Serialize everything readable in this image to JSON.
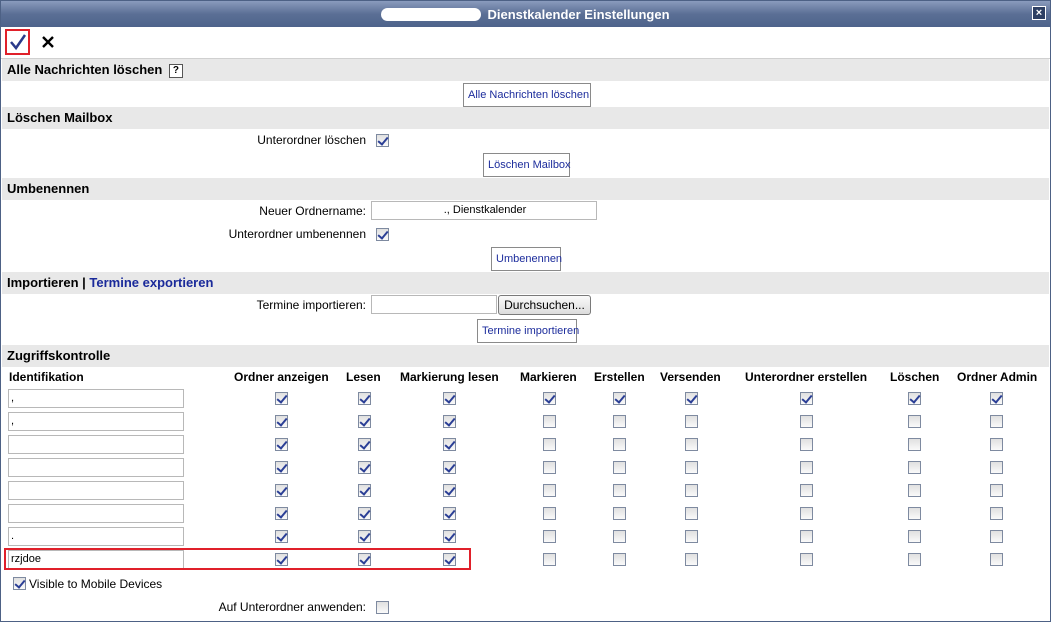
{
  "window": {
    "title": "Dienstkalender Einstellungen",
    "close_glyph": "×"
  },
  "toolbar": {
    "ok_icon": "check-icon",
    "cancel_icon": "close-icon"
  },
  "sections": {
    "delete_messages": {
      "header": "Alle Nachrichten löschen",
      "help": "?",
      "button": "Alle Nachrichten löschen"
    },
    "delete_mailbox": {
      "header": "Löschen Mailbox",
      "subfolder_label": "Unterordner löschen",
      "subfolder_checked": true,
      "button": "Löschen Mailbox"
    },
    "rename": {
      "header": "Umbenennen",
      "new_name_label": "Neuer Ordnername:",
      "new_name_value": "., Dienstkalender",
      "rename_sub_label": "Unterordner umbenennen",
      "rename_sub_checked": true,
      "button": "Umbenennen"
    },
    "import": {
      "header_import": "Importieren",
      "separator": " | ",
      "header_export": "Termine exportieren",
      "label": "Termine importieren:",
      "file_value": "",
      "browse_button": "Durchsuchen...",
      "import_button": "Termine importieren"
    },
    "acl": {
      "header": "Zugriffskontrolle",
      "columns": [
        "Identifikation",
        "Ordner anzeigen",
        "Lesen",
        "Markierung lesen",
        "Markieren",
        "Erstellen",
        "Versenden",
        "Unterordner erstellen",
        "Löschen",
        "Ordner Admin"
      ],
      "rows": [
        {
          "id": ",",
          "perms": [
            true,
            true,
            true,
            true,
            true,
            true,
            true,
            true,
            true
          ]
        },
        {
          "id": ",",
          "perms": [
            true,
            true,
            true,
            false,
            false,
            false,
            false,
            false,
            false
          ]
        },
        {
          "id": "",
          "perms": [
            true,
            true,
            true,
            false,
            false,
            false,
            false,
            false,
            false
          ]
        },
        {
          "id": "",
          "perms": [
            true,
            true,
            true,
            false,
            false,
            false,
            false,
            false,
            false
          ]
        },
        {
          "id": "",
          "perms": [
            true,
            true,
            true,
            false,
            false,
            false,
            false,
            false,
            false
          ]
        },
        {
          "id": "",
          "perms": [
            true,
            true,
            true,
            false,
            false,
            false,
            false,
            false,
            false
          ]
        },
        {
          "id": ".",
          "perms": [
            true,
            true,
            true,
            false,
            false,
            false,
            false,
            false,
            false
          ]
        },
        {
          "id": "rzjdoe",
          "perms": [
            true,
            true,
            true,
            false,
            false,
            false,
            false,
            false,
            false
          ]
        }
      ],
      "mobile_label": "Visible to Mobile Devices",
      "mobile_checked": true,
      "apply_sub_label": "Auf Unterordner anwenden:",
      "apply_sub_checked": false
    }
  },
  "colors": {
    "titlebar": "#5b6f95",
    "section_bg": "#e8e8e8",
    "link": "#1a2a9a",
    "highlight": "#e0202a"
  }
}
